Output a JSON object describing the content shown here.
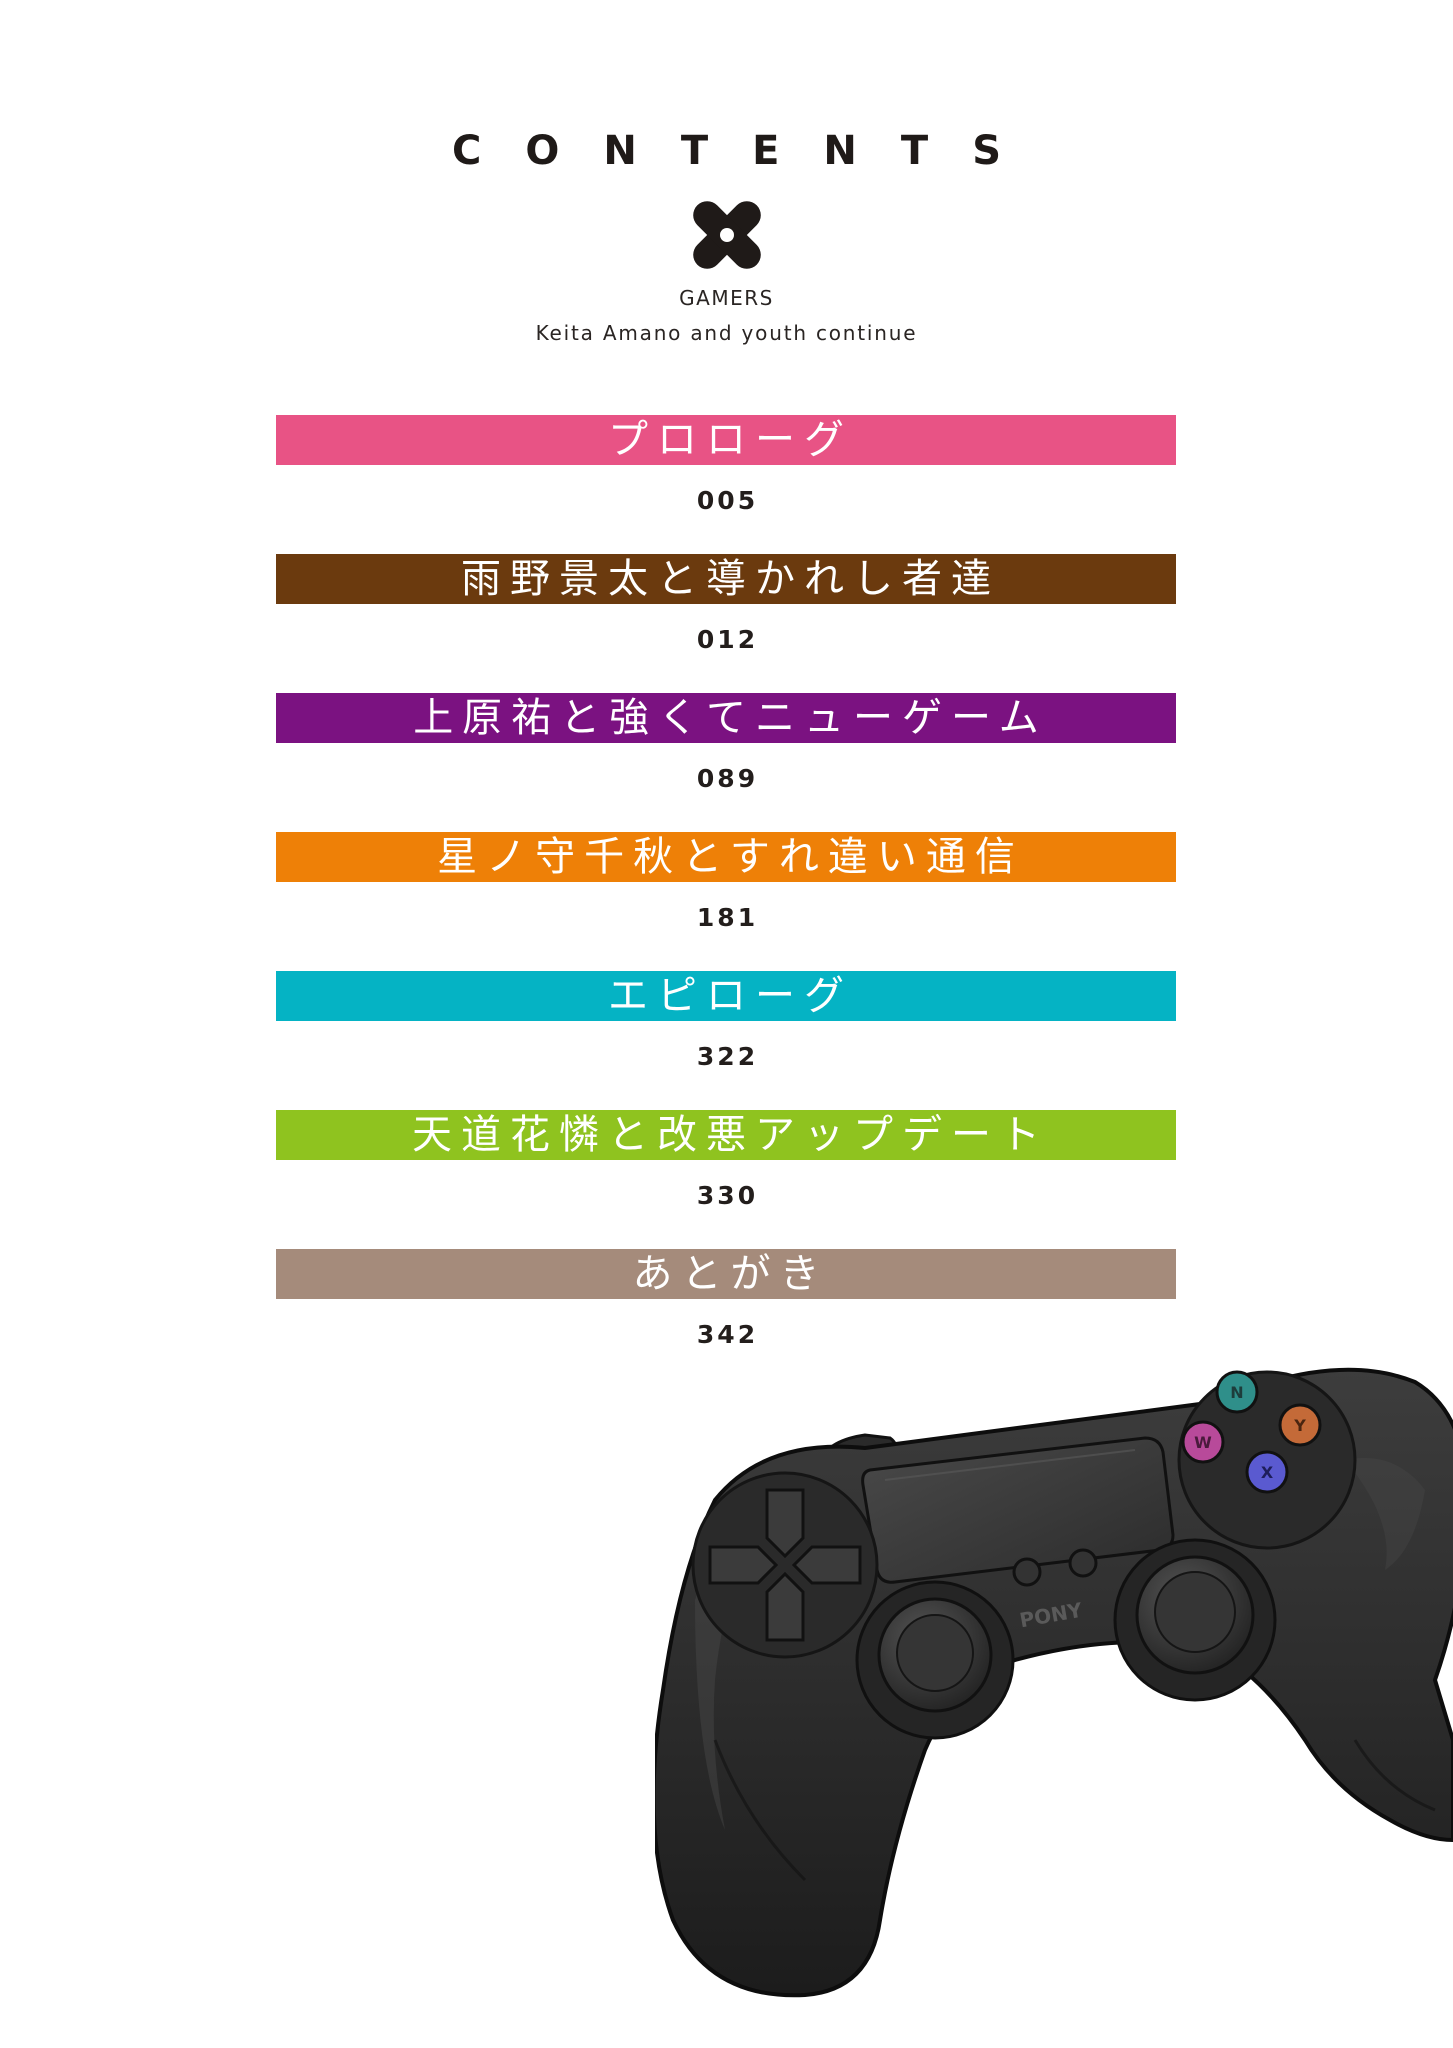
{
  "heading": "CONTENTS",
  "brand": "GAMERS",
  "subtitle": "Keita Amano and youth continue",
  "entries": [
    {
      "title": "プロローグ",
      "page": "005",
      "color": "#e85385"
    },
    {
      "title": "雨野景太と導かれし者達",
      "page": "012",
      "color": "#6b3a0e"
    },
    {
      "title": "上原祐と強くてニューゲーム",
      "page": "089",
      "color": "#7b1281"
    },
    {
      "title": "星ノ守千秋とすれ違い通信",
      "page": "181",
      "color": "#ee8007"
    },
    {
      "title": "エピローグ",
      "page": "322",
      "color": "#05b3c4"
    },
    {
      "title": "天道花憐と改悪アップデート",
      "page": "330",
      "color": "#8fc31f"
    },
    {
      "title": "あとがき",
      "page": "342",
      "color": "#a58b7b"
    }
  ],
  "controller": {
    "brand": "PONY",
    "buttons": [
      "N",
      "Y",
      "W",
      "X"
    ]
  }
}
